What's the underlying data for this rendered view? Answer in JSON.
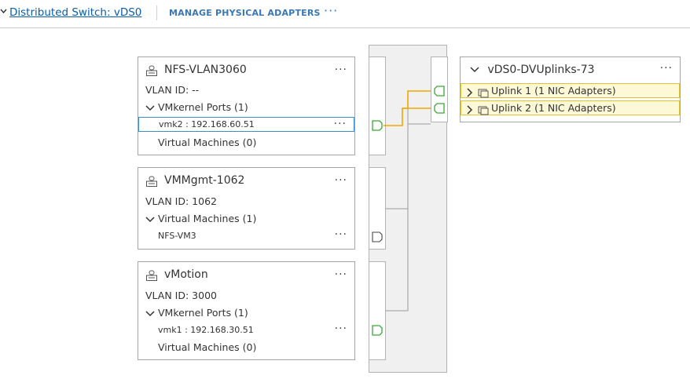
{
  "header": {
    "collapse_glyph": "✓",
    "title": "Distributed Switch: vDS0",
    "manage_label": "MANAGE PHYSICAL ADAPTERS",
    "more_label": "···"
  },
  "port_groups": [
    {
      "name": "NFS-VLAN3060",
      "vlan": "VLAN ID: --",
      "section": "VMkernel Ports (1)",
      "item": "vmk2 : 192.168.60.51",
      "footer": "Virtual Machines (0)",
      "more": "···"
    },
    {
      "name": "VMMgmt-1062",
      "vlan": "VLAN ID: 1062",
      "section": "Virtual Machines (1)",
      "item": "NFS-VM3",
      "more": "···"
    },
    {
      "name": "vMotion",
      "vlan": "VLAN ID: 3000",
      "section": "VMkernel Ports (1)",
      "item": "vmk1 : 192.168.30.51",
      "footer": "Virtual Machines (0)",
      "more": "···"
    }
  ],
  "uplinks": {
    "name": "vDS0-DVUplinks-73",
    "more": "···",
    "items": [
      {
        "label": "Uplink 1 (1 NIC Adapters)"
      },
      {
        "label": "Uplink 2 (1 NIC Adapters)"
      }
    ]
  },
  "colors": {
    "accent": "#0a5da8",
    "link_highlight": "#f0a800",
    "selection_border": "#3a8fc7",
    "uplink_bg": "#fdf8d6",
    "uplink_border": "#e0c23a",
    "connector_port": "#3aa83a"
  },
  "icons": [
    "portgroup-icon",
    "chevron-down-icon",
    "chevron-right-icon",
    "nic-icon",
    "port-icon"
  ]
}
